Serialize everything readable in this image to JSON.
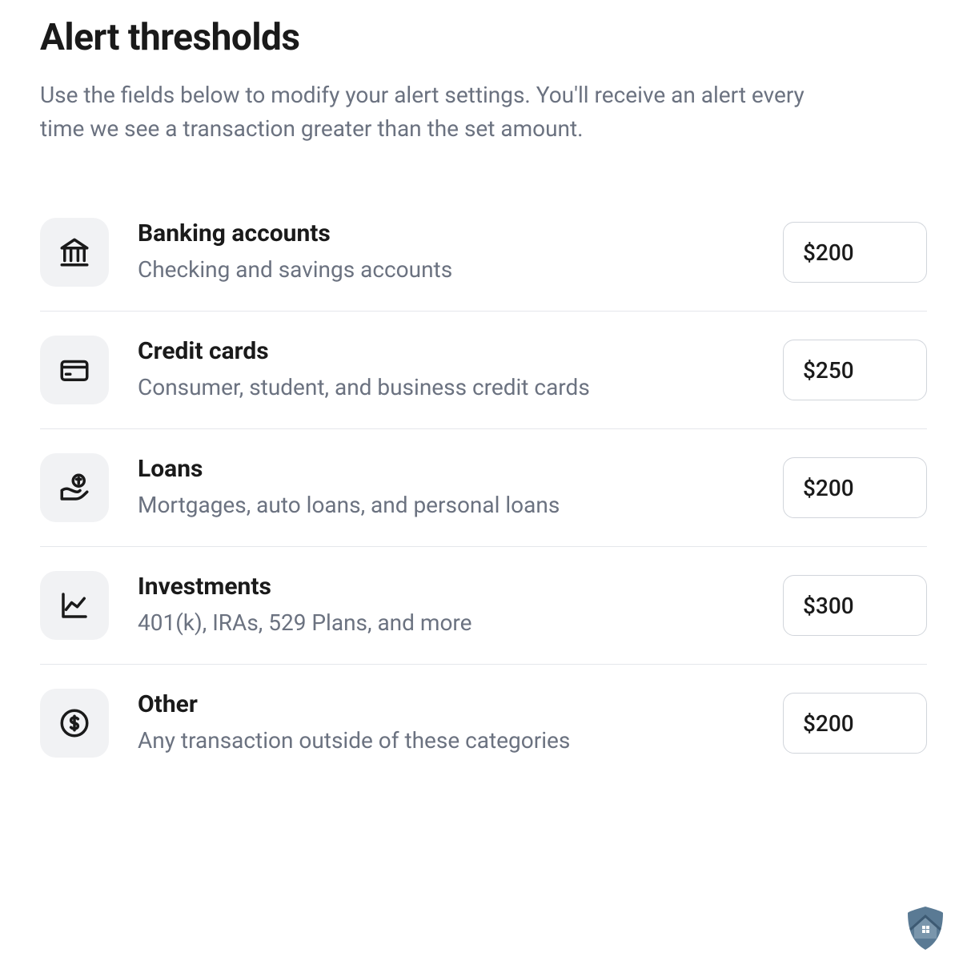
{
  "page": {
    "title": "Alert thresholds",
    "description": "Use the fields below to modify your alert settings. You'll receive an alert every time we see a transaction greater than the set amount."
  },
  "rows": [
    {
      "icon": "bank",
      "title": "Banking accounts",
      "desc": "Checking and savings accounts",
      "value": "$200"
    },
    {
      "icon": "card",
      "title": "Credit cards",
      "desc": "Consumer, student, and business credit cards",
      "value": "$250"
    },
    {
      "icon": "loan",
      "title": "Loans",
      "desc": "Mortgages, auto loans, and personal loans",
      "value": "$200"
    },
    {
      "icon": "chart",
      "title": "Investments",
      "desc": "401(k), IRAs, 529 Plans, and more",
      "value": "$300"
    },
    {
      "icon": "dollar",
      "title": "Other",
      "desc": "Any transaction outside of these categories",
      "value": "$200"
    }
  ]
}
